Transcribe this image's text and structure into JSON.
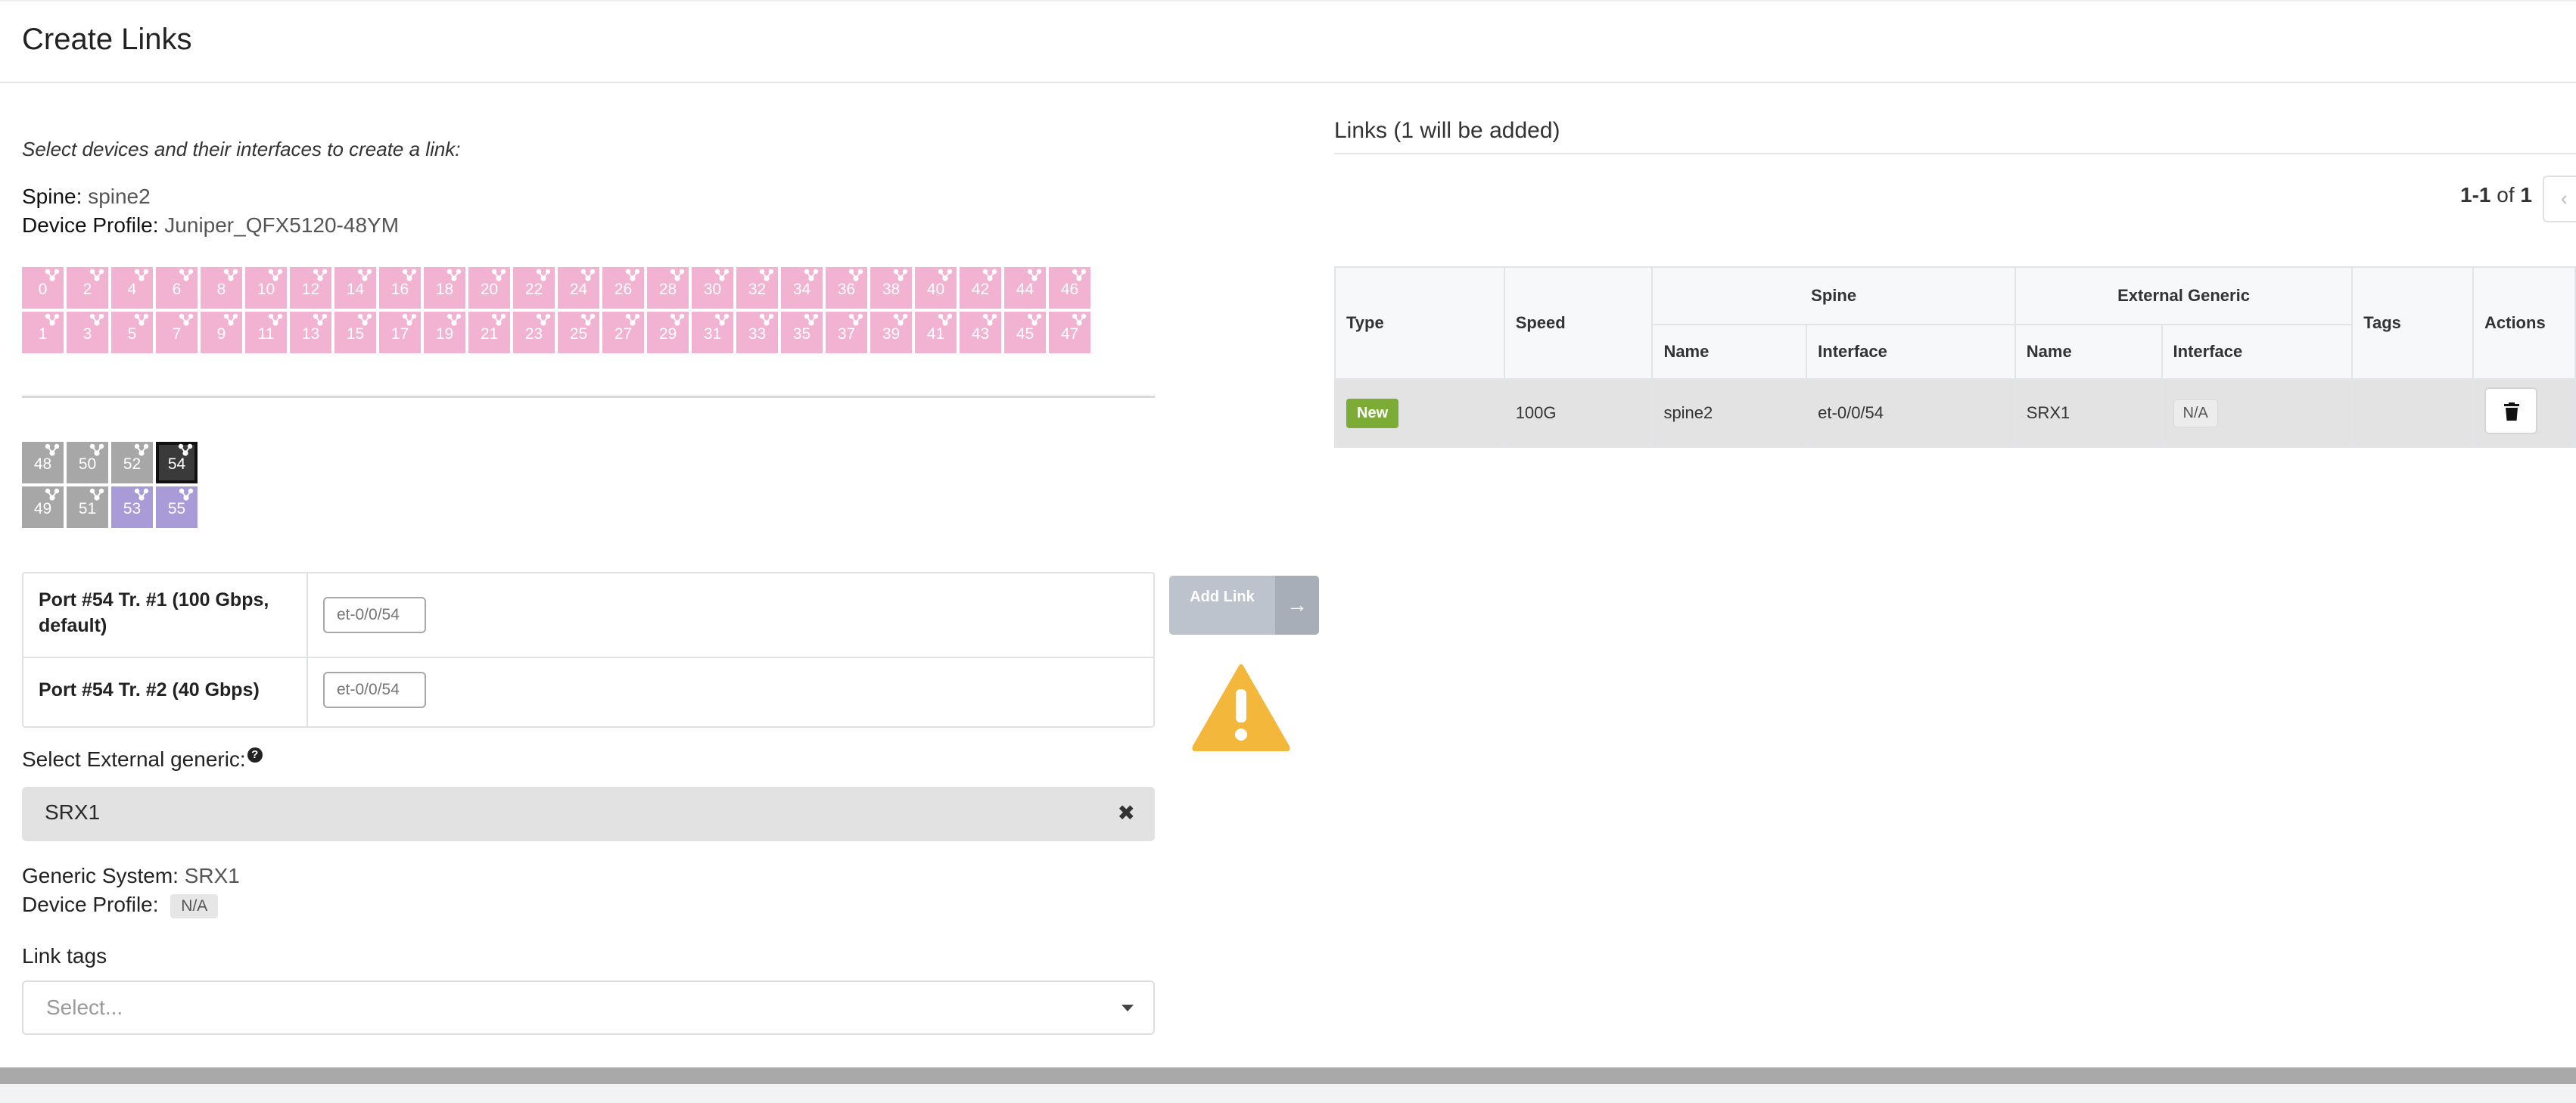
{
  "page": {
    "title": "Create Links"
  },
  "left": {
    "instruction": "Select devices and their interfaces to create a link:",
    "spine_label": "Spine:",
    "spine_value": "spine2",
    "profile_label": "Device Profile:",
    "profile_value": "Juniper_QFX5120-48YM",
    "port_rows_a": [
      [
        "0",
        "2",
        "4",
        "6",
        "8",
        "10",
        "12",
        "14",
        "16",
        "18",
        "20",
        "22",
        "24",
        "26",
        "28",
        "30",
        "32",
        "34",
        "36",
        "38",
        "40",
        "42",
        "44",
        "46"
      ],
      [
        "1",
        "3",
        "5",
        "7",
        "9",
        "11",
        "13",
        "15",
        "17",
        "19",
        "21",
        "23",
        "25",
        "27",
        "29",
        "31",
        "33",
        "35",
        "37",
        "39",
        "41",
        "43",
        "45",
        "47"
      ]
    ],
    "port_rows_b": [
      [
        {
          "n": "48",
          "s": "gray"
        },
        {
          "n": "50",
          "s": "gray"
        },
        {
          "n": "52",
          "s": "gray"
        },
        {
          "n": "54",
          "s": "selected"
        }
      ],
      [
        {
          "n": "49",
          "s": "gray"
        },
        {
          "n": "51",
          "s": "gray"
        },
        {
          "n": "53",
          "s": "purple"
        },
        {
          "n": "55",
          "s": "purple"
        }
      ]
    ],
    "interfaces": [
      {
        "label": "Port #54 Tr. #1 (100 Gbps, default)",
        "placeholder": "et-0/0/54"
      },
      {
        "label": "Port #54 Tr. #2 (40 Gbps)",
        "placeholder": "et-0/0/54"
      }
    ],
    "external_label": "Select External generic:",
    "help_glyph": "?",
    "external_value": "SRX1",
    "clear_glyph": "✖",
    "generic_system_label": "Generic System:",
    "generic_system_value": "SRX1",
    "generic_profile_label": "Device Profile:",
    "generic_profile_value": "N/A",
    "tags_label": "Link tags",
    "tags_placeholder": "Select..."
  },
  "add_link": {
    "label": "Add Link",
    "arrow_glyph": "→"
  },
  "right": {
    "links_title": "Links (1 will be added)",
    "pager_range": "1-1",
    "pager_of": "of",
    "pager_total": "1",
    "pager_prev_glyph": "‹",
    "columns": {
      "type": "Type",
      "speed": "Speed",
      "spine": "Spine",
      "external": "External Generic",
      "name": "Name",
      "interface": "Interface",
      "tags": "Tags",
      "actions": "Actions"
    },
    "rows": [
      {
        "status": "New",
        "speed": "100G",
        "spine_name": "spine2",
        "spine_interface": "et-0/0/54",
        "ext_name": "SRX1",
        "ext_interface": "N/A",
        "tags": ""
      }
    ]
  },
  "colors": {
    "port_available": "#f2b3d2",
    "port_used": "#a7a7a7",
    "port_other": "#a89bd8",
    "port_selected": "#3a3a3a",
    "new_badge": "#7cab36",
    "warning": "#f3b73b"
  },
  "icons": {
    "port": "port-icon",
    "help": "question-circle-icon",
    "clear": "times-icon",
    "dropdown": "caret-down-icon",
    "add": "arrow-right-icon",
    "warning": "warning-triangle-icon",
    "delete": "trash-icon",
    "prev": "chevron-left-icon"
  }
}
